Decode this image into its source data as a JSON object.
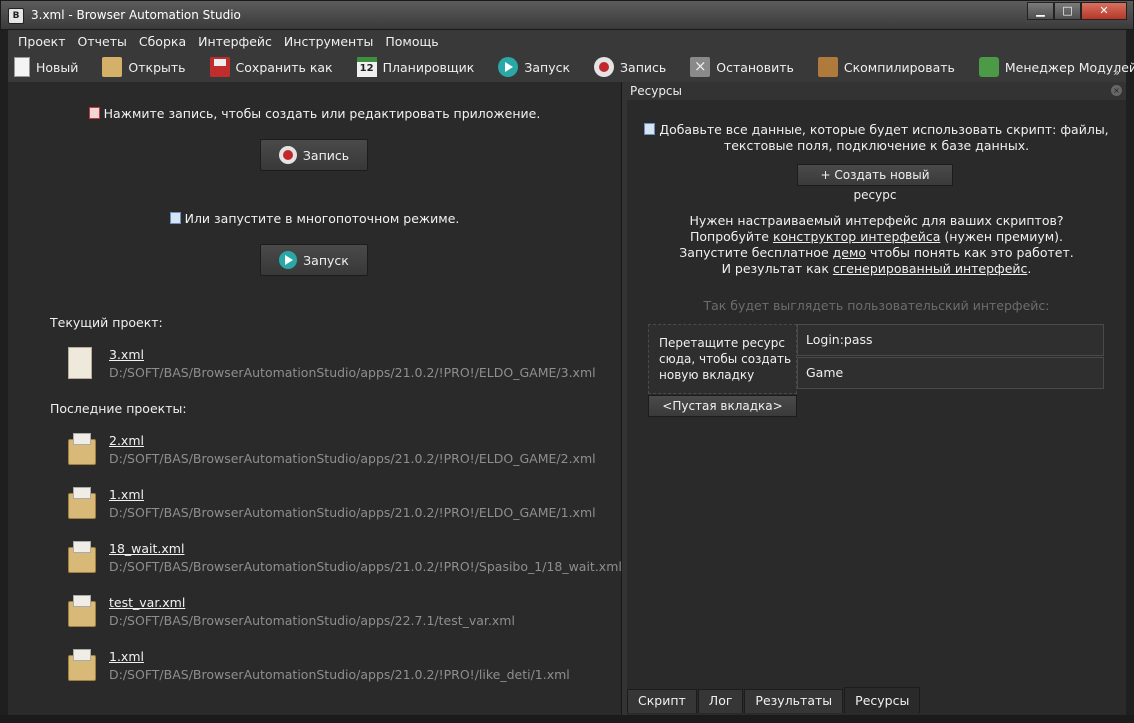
{
  "window": {
    "title": "3.xml - Browser Automation Studio",
    "app_icon_letter": "B",
    "min_label": "▁",
    "max_label": "□",
    "close_label": "✕"
  },
  "menu": [
    "Проект",
    "Отчеты",
    "Сборка",
    "Интерфейс",
    "Инструменты",
    "Помощь"
  ],
  "toolbar": {
    "new": "Новый",
    "open": "Открыть",
    "save_as": "Сохранить как",
    "scheduler": "Планировщик",
    "scheduler_icon_number": "12",
    "run": "Запуск",
    "record": "Запись",
    "stop": "Остановить",
    "compile": "Скомпилировать",
    "modules": "Менеджер Модулей",
    "more": "»"
  },
  "left": {
    "record_hint": "Нажмите запись, чтобы создать или редактировать приложение.",
    "record_button": "Запись",
    "run_hint": "Или запустите в многопоточном режиме.",
    "run_button": "Запуск",
    "current_project_label": "Текущий проект:",
    "current_project": {
      "name": "3.xml",
      "path": "D:/SOFT/BAS/BrowserAutomationStudio/apps/21.0.2/!PRO!/ELDO_GAME/3.xml"
    },
    "recent_label": "Последние проекты:",
    "recent": [
      {
        "name": "2.xml",
        "path": "D:/SOFT/BAS/BrowserAutomationStudio/apps/21.0.2/!PRO!/ELDO_GAME/2.xml"
      },
      {
        "name": "1.xml",
        "path": "D:/SOFT/BAS/BrowserAutomationStudio/apps/21.0.2/!PRO!/ELDO_GAME/1.xml"
      },
      {
        "name": "18_wait.xml",
        "path": "D:/SOFT/BAS/BrowserAutomationStudio/apps/21.0.2/!PRO!/Spasibo_1/18_wait.xml"
      },
      {
        "name": "test_var.xml",
        "path": "D:/SOFT/BAS/BrowserAutomationStudio/apps/22.7.1/test_var.xml"
      },
      {
        "name": "1.xml",
        "path": "D:/SOFT/BAS/BrowserAutomationStudio/apps/21.0.2/!PRO!/like_deti/1.xml"
      }
    ]
  },
  "right": {
    "panel_title": "Ресурсы",
    "intro_line1": "Добавьте все данные, которые будет использовать скрипт: файлы,",
    "intro_line2": "текстовые поля, подключение к базе данных.",
    "create_button": "+ Создать новый ресурс",
    "ui_line1": "Нужен настраиваемый интерфейс для ваших скриптов?",
    "ui_line2_a": "Попробуйте ",
    "ui_line2_link": "конструктор интерфейса",
    "ui_line2_b": " (нужен премиум).",
    "ui_line3_a": "Запустите бесплатное ",
    "ui_line3_link": "демо",
    "ui_line3_b": " чтобы понять как это работет.",
    "ui_line4_a": "И результат как ",
    "ui_line4_link": "сгенерированный интерфейс",
    "ui_line4_b": ".",
    "preview_label": "Так будет выглядеть пользовательский интерфейс:",
    "drop_zone": "Перетащите ресурс сюда, чтобы создать новую вкладку",
    "resources": [
      "Login:pass",
      "Game"
    ],
    "empty_tab": "<Пустая вкладка>",
    "tabs": [
      "Скрипт",
      "Лог",
      "Результаты",
      "Ресурсы"
    ],
    "active_tab": "Ресурсы"
  }
}
